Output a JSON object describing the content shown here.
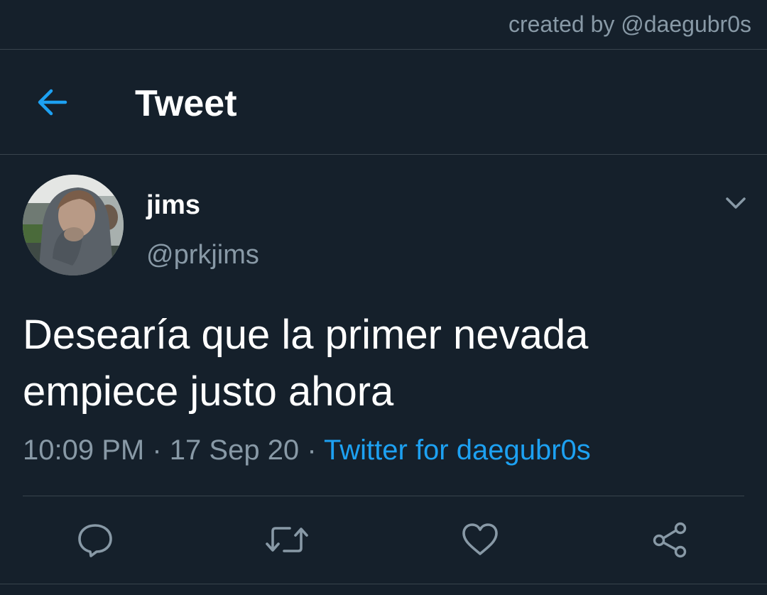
{
  "credit": "created by @daegubr0s",
  "header": {
    "title": "Tweet",
    "back_icon": "arrow-left-icon"
  },
  "tweet": {
    "display_name": "jims",
    "handle": "@prkjims",
    "text_lines": [
      "Desearía que la primer nevada",
      "empiece justo ahora"
    ],
    "time": "10:09 PM",
    "date": "17 Sep 20",
    "separator": "·",
    "source": "Twitter for daegubr0s"
  },
  "actions": [
    {
      "name": "reply",
      "icon": "speech-bubble-icon"
    },
    {
      "name": "retweet",
      "icon": "retweet-icon"
    },
    {
      "name": "like",
      "icon": "heart-icon"
    },
    {
      "name": "share",
      "icon": "share-icon"
    }
  ],
  "colors": {
    "background": "#15202b",
    "accent": "#1da1f2",
    "secondary_text": "#8899a6",
    "divider": "#38444d"
  }
}
